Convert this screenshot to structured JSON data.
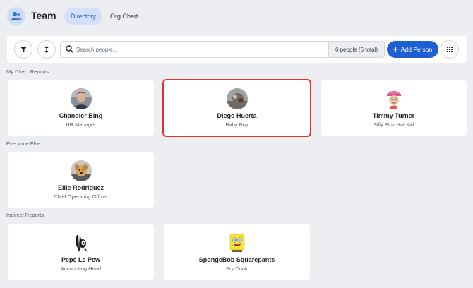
{
  "header": {
    "title": "Team",
    "tabs": [
      {
        "label": "Directory",
        "active": true
      },
      {
        "label": "Org Chart",
        "active": false
      }
    ]
  },
  "toolbar": {
    "search_placeholder": "Search people...",
    "count_text": "6 people (6 total)",
    "add_label": "Add Person"
  },
  "colors": {
    "accent": "#1e5fd1",
    "selected_outline": "#e0302b",
    "background": "#eceef1"
  },
  "sections": [
    {
      "label": "My Direct Reports",
      "people": [
        {
          "name": "Chandler Bing",
          "role": "HR Manager",
          "avatar": "photo-avatar"
        },
        {
          "name": "Diego Huerta",
          "role": "Baby Boy",
          "avatar": "photo-avatar",
          "selected": true
        },
        {
          "name": "Timmy Turner",
          "role": "Silly Pink Hat Kid",
          "avatar": "cartoon-avatar"
        }
      ]
    },
    {
      "label": "Everyone Else",
      "people": [
        {
          "name": "Ellie Rodriguez",
          "role": "Chief Operating Officer",
          "avatar": "photo-avatar"
        }
      ]
    },
    {
      "label": "Indirect Reports",
      "people": [
        {
          "name": "Pepé Le Pew",
          "role": "Accounting Head",
          "avatar": "cartoon-avatar"
        },
        {
          "name": "SpongeBob Squarepants",
          "role": "Fry Cook",
          "avatar": "cartoon-avatar"
        }
      ]
    }
  ]
}
